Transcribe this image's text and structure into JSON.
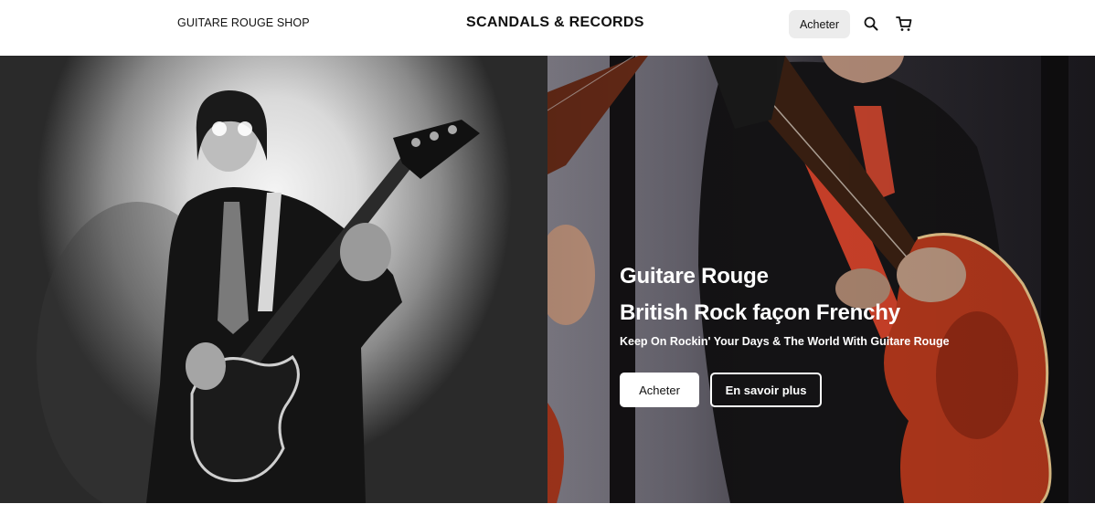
{
  "header": {
    "shop_link": "GUITARE ROUGE SHOP",
    "site_title": "SCANDALS & RECORDS",
    "buy_button": "Acheter",
    "search_icon": "search-icon",
    "cart_icon": "cart-icon"
  },
  "hero": {
    "title_line1": "Guitare Rouge",
    "title_line2": "British Rock façon Frenchy",
    "subtitle": "Keep On Rockin' Your Days & The World With Guitare Rouge",
    "primary_button": "Acheter",
    "secondary_button": "En savoir plus",
    "left_image_alt": "guitarist-black-and-white-photo",
    "right_image_alt": "guitarist-red-guitar-photo"
  },
  "colors": {
    "accent": "#c62d1f",
    "header_button_bg": "#ececec",
    "text": "#111111"
  }
}
